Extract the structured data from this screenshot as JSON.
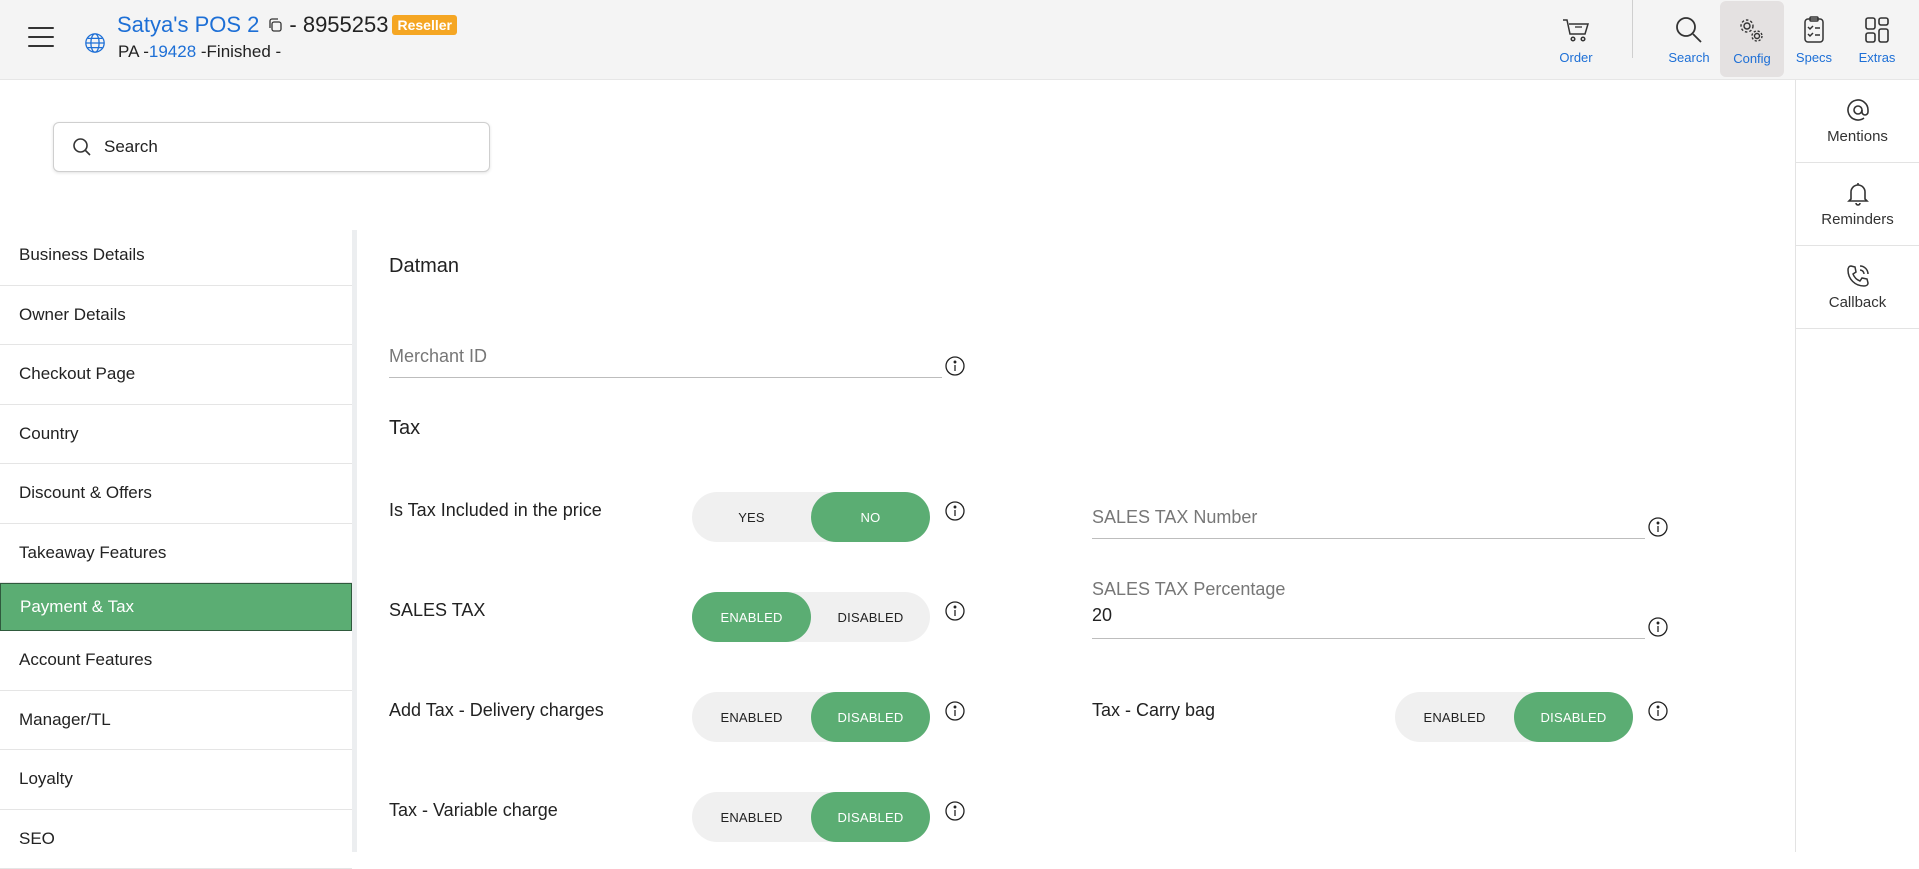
{
  "header": {
    "store_name": "Satya's POS 2",
    "store_id": "- 8955253",
    "badge": "Reseller",
    "sub_prefix": "PA -",
    "sub_link": "19428",
    "sub_suffix": " -Finished -",
    "buttons": {
      "order": "Order",
      "search": "Search",
      "config": "Config",
      "specs": "Specs",
      "extras": "Extras"
    }
  },
  "right_panel": {
    "mentions": "Mentions",
    "reminders": "Reminders",
    "callback": "Callback"
  },
  "search": {
    "placeholder": "Search"
  },
  "sidebar": {
    "items": [
      {
        "label": "Business Details"
      },
      {
        "label": "Owner Details"
      },
      {
        "label": "Checkout Page"
      },
      {
        "label": "Country"
      },
      {
        "label": "Discount & Offers"
      },
      {
        "label": "Takeaway Features"
      },
      {
        "label": "Payment & Tax"
      },
      {
        "label": "Account Features"
      },
      {
        "label": "Manager/TL"
      },
      {
        "label": "Loyalty"
      },
      {
        "label": "SEO"
      }
    ],
    "active_index": 6
  },
  "main": {
    "datman_title": "Datman",
    "merchant_id_label": "Merchant ID",
    "tax_title": "Tax",
    "tax_included": {
      "label": "Is Tax Included in the price",
      "options": [
        "YES",
        "NO"
      ],
      "selected": "NO"
    },
    "sales_tax": {
      "label": "SALES TAX",
      "options": [
        "ENABLED",
        "DISABLED"
      ],
      "selected": "ENABLED"
    },
    "delivery_tax": {
      "label": "Add Tax - Delivery charges",
      "options": [
        "ENABLED",
        "DISABLED"
      ],
      "selected": "DISABLED"
    },
    "variable_tax": {
      "label": "Tax - Variable charge",
      "options": [
        "ENABLED",
        "DISABLED"
      ],
      "selected": "DISABLED"
    },
    "carry_bag_tax": {
      "label": "Tax - Carry bag",
      "options": [
        "ENABLED",
        "DISABLED"
      ],
      "selected": "DISABLED"
    },
    "sales_tax_number_label": "SALES TAX Number",
    "sales_tax_percentage_label": "SALES TAX Percentage",
    "sales_tax_percentage_value": "20"
  },
  "colors": {
    "accent": "#5bad73",
    "link": "#1d6fd6",
    "badge": "#f5a623"
  }
}
